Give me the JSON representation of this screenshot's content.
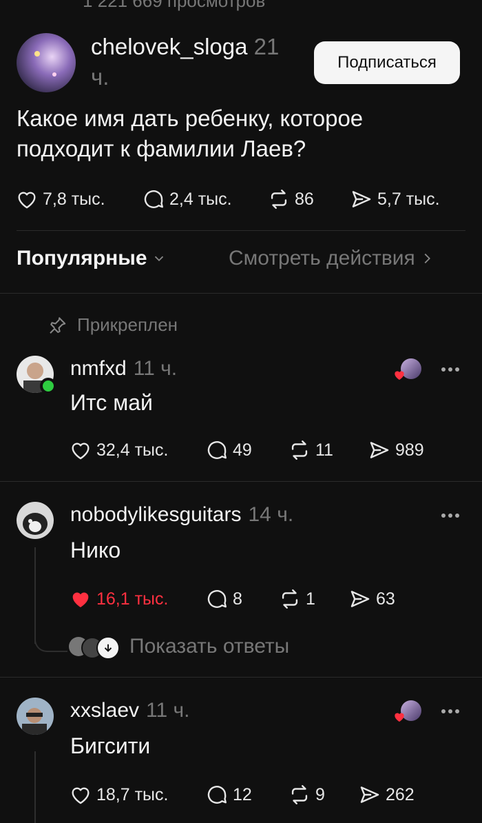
{
  "header": {
    "views": "1 221 669 просмотров"
  },
  "post": {
    "author": "chelovek_sloga",
    "time": "21 ч.",
    "follow_label": "Подписаться",
    "text": "Какое имя дать ребенку, которое подходит к фамилии Лаев?",
    "likes": "7,8 тыс.",
    "comments": "2,4 тыс.",
    "reposts": "86",
    "shares": "5,7 тыс."
  },
  "tabs": {
    "popular": "Популярные",
    "activity": "Смотреть действия"
  },
  "pinned_label": "Прикреплен",
  "comments": [
    {
      "author": "nmfxd",
      "time": "11 ч.",
      "text": "Итс май",
      "likes": "32,4 тыс.",
      "comments": "49",
      "reposts": "11",
      "shares": "989",
      "liked": false
    },
    {
      "author": "nobodylikesguitars",
      "time": "14 ч.",
      "text": "Нико",
      "likes": "16,1 тыс.",
      "comments": "8",
      "reposts": "1",
      "shares": "63",
      "liked": true,
      "show_replies": "Показать ответы"
    },
    {
      "author": "xxslaev",
      "time": "11 ч.",
      "text": "Бигсити",
      "likes": "18,7 тыс.",
      "comments": "12",
      "reposts": "9",
      "shares": "262",
      "liked": false
    }
  ],
  "colors": {
    "background": "#101010",
    "like_active": "#ff3040",
    "online": "#2ecc40",
    "muted": "#777777"
  },
  "icons": [
    "heart-icon",
    "comment-icon",
    "repost-icon",
    "share-icon",
    "pin-icon",
    "more-icon",
    "chevron-down-icon",
    "chevron-right-icon",
    "arrow-down-icon"
  ]
}
